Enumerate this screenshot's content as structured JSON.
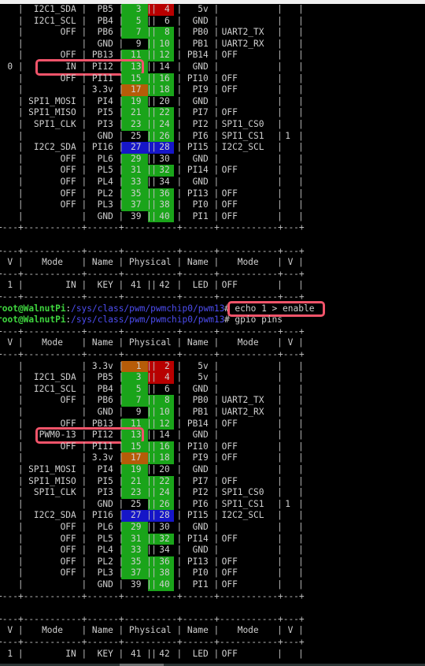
{
  "terminal": {
    "prompt_user": "root@WalnutPi",
    "prompt_path": "/sys/class/pwm/pwmchip0/pwm13",
    "commands": [
      {
        "text": "echo 1 > enable",
        "highlighted": true
      },
      {
        "text": "gpio pins",
        "highlighted": false
      }
    ]
  },
  "table_header": {
    "v": "V",
    "mode": "Mode",
    "name": "Name",
    "physical": "Physical"
  },
  "tables": [
    {
      "id": "before",
      "rows": [
        {
          "lv": "",
          "lmode": "I2C1_SDA",
          "lname": "PB5",
          "lpin": "3",
          "lcolor": "green",
          "rpin": "4",
          "rcolor": "red",
          "rname": "5v",
          "rmode": "",
          "rv": ""
        },
        {
          "lv": "",
          "lmode": "I2C1_SCL",
          "lname": "PB4",
          "lpin": "5",
          "lcolor": "green",
          "rpin": "6",
          "rcolor": "none",
          "rname": "GND",
          "rmode": "",
          "rv": ""
        },
        {
          "lv": "",
          "lmode": "OFF",
          "lname": "PB6",
          "lpin": "7",
          "lcolor": "green",
          "rpin": "8",
          "rcolor": "green",
          "rname": "PB0",
          "rmode": "UART2_TX",
          "rv": ""
        },
        {
          "lv": "",
          "lmode": "",
          "lname": "GND",
          "lpin": "9",
          "lcolor": "none",
          "rpin": "10",
          "rcolor": "green",
          "rname": "PB1",
          "rmode": "UART2_RX",
          "rv": ""
        },
        {
          "lv": "",
          "lmode": "OFF",
          "lname": "PB13",
          "lpin": "11",
          "lcolor": "green",
          "rpin": "12",
          "rcolor": "green",
          "rname": "PB14",
          "rmode": "OFF",
          "rv": ""
        },
        {
          "lv": "0",
          "lmode": "IN",
          "lname": "PI12",
          "lpin": "13",
          "lcolor": "green",
          "rpin": "14",
          "rcolor": "none",
          "rname": "GND",
          "rmode": "",
          "rv": "",
          "highlight": true
        },
        {
          "lv": "",
          "lmode": "OFF",
          "lname": "PI11",
          "lpin": "15",
          "lcolor": "green",
          "rpin": "16",
          "rcolor": "green",
          "rname": "PI10",
          "rmode": "OFF",
          "rv": ""
        },
        {
          "lv": "",
          "lmode": "",
          "lname": "3.3v",
          "lpin": "17",
          "lcolor": "orange",
          "rpin": "18",
          "rcolor": "green",
          "rname": "PI9",
          "rmode": "OFF",
          "rv": ""
        },
        {
          "lv": "",
          "lmode": "SPI1_MOSI",
          "lname": "PI4",
          "lpin": "19",
          "lcolor": "green",
          "rpin": "20",
          "rcolor": "none",
          "rname": "GND",
          "rmode": "",
          "rv": ""
        },
        {
          "lv": "",
          "lmode": "SPI1_MISO",
          "lname": "PI5",
          "lpin": "21",
          "lcolor": "green",
          "rpin": "22",
          "rcolor": "green",
          "rname": "PI7",
          "rmode": "OFF",
          "rv": ""
        },
        {
          "lv": "",
          "lmode": "SPI1_CLK",
          "lname": "PI3",
          "lpin": "23",
          "lcolor": "green",
          "rpin": "24",
          "rcolor": "green",
          "rname": "PI2",
          "rmode": "SPI1_CS0",
          "rv": ""
        },
        {
          "lv": "",
          "lmode": "",
          "lname": "GND",
          "lpin": "25",
          "lcolor": "none",
          "rpin": "26",
          "rcolor": "green",
          "rname": "PI6",
          "rmode": "SPI1_CS1",
          "rv": "1"
        },
        {
          "lv": "",
          "lmode": "I2C2_SDA",
          "lname": "PI16",
          "lpin": "27",
          "lcolor": "blue",
          "rpin": "28",
          "rcolor": "blue",
          "rname": "PI15",
          "rmode": "I2C2_SCL",
          "rv": ""
        },
        {
          "lv": "",
          "lmode": "OFF",
          "lname": "PL6",
          "lpin": "29",
          "lcolor": "green",
          "rpin": "30",
          "rcolor": "none",
          "rname": "GND",
          "rmode": "",
          "rv": ""
        },
        {
          "lv": "",
          "lmode": "OFF",
          "lname": "PL5",
          "lpin": "31",
          "lcolor": "green",
          "rpin": "32",
          "rcolor": "green",
          "rname": "PI14",
          "rmode": "OFF",
          "rv": ""
        },
        {
          "lv": "",
          "lmode": "OFF",
          "lname": "PL4",
          "lpin": "33",
          "lcolor": "green",
          "rpin": "34",
          "rcolor": "none",
          "rname": "GND",
          "rmode": "",
          "rv": ""
        },
        {
          "lv": "",
          "lmode": "OFF",
          "lname": "PL2",
          "lpin": "35",
          "lcolor": "green",
          "rpin": "36",
          "rcolor": "green",
          "rname": "PI13",
          "rmode": "OFF",
          "rv": ""
        },
        {
          "lv": "",
          "lmode": "OFF",
          "lname": "PL3",
          "lpin": "37",
          "lcolor": "green",
          "rpin": "38",
          "rcolor": "green",
          "rname": "PI0",
          "rmode": "OFF",
          "rv": ""
        },
        {
          "lv": "",
          "lmode": "",
          "lname": "GND",
          "lpin": "39",
          "lcolor": "none",
          "rpin": "40",
          "rcolor": "green",
          "rname": "PI1",
          "rmode": "OFF",
          "rv": ""
        }
      ],
      "extra_row": {
        "lv": "1",
        "lmode": "IN",
        "lname": "KEY",
        "lpin": "41",
        "rpin": "42",
        "rname": "LED",
        "rmode": "OFF",
        "rv": ""
      }
    },
    {
      "id": "after",
      "rows": [
        {
          "lv": "",
          "lmode": "",
          "lname": "3.3v",
          "lpin": "1",
          "lcolor": "orange",
          "rpin": "2",
          "rcolor": "red",
          "rname": "5v",
          "rmode": "",
          "rv": ""
        },
        {
          "lv": "",
          "lmode": "I2C1_SDA",
          "lname": "PB5",
          "lpin": "3",
          "lcolor": "green",
          "rpin": "4",
          "rcolor": "red",
          "rname": "5v",
          "rmode": "",
          "rv": ""
        },
        {
          "lv": "",
          "lmode": "I2C1_SCL",
          "lname": "PB4",
          "lpin": "5",
          "lcolor": "green",
          "rpin": "6",
          "rcolor": "none",
          "rname": "GND",
          "rmode": "",
          "rv": ""
        },
        {
          "lv": "",
          "lmode": "OFF",
          "lname": "PB6",
          "lpin": "7",
          "lcolor": "green",
          "rpin": "8",
          "rcolor": "green",
          "rname": "PB0",
          "rmode": "UART2_TX",
          "rv": ""
        },
        {
          "lv": "",
          "lmode": "",
          "lname": "GND",
          "lpin": "9",
          "lcolor": "none",
          "rpin": "10",
          "rcolor": "green",
          "rname": "PB1",
          "rmode": "UART2_RX",
          "rv": ""
        },
        {
          "lv": "",
          "lmode": "OFF",
          "lname": "PB13",
          "lpin": "11",
          "lcolor": "green",
          "rpin": "12",
          "rcolor": "green",
          "rname": "PB14",
          "rmode": "OFF",
          "rv": ""
        },
        {
          "lv": "",
          "lmode": "PWM0-13",
          "lname": "PI12",
          "lpin": "13",
          "lcolor": "green",
          "rpin": "14",
          "rcolor": "none",
          "rname": "GND",
          "rmode": "",
          "rv": "",
          "highlight": true
        },
        {
          "lv": "",
          "lmode": "OFF",
          "lname": "PI11",
          "lpin": "15",
          "lcolor": "green",
          "rpin": "16",
          "rcolor": "green",
          "rname": "PI10",
          "rmode": "OFF",
          "rv": ""
        },
        {
          "lv": "",
          "lmode": "",
          "lname": "3.3v",
          "lpin": "17",
          "lcolor": "orange",
          "rpin": "18",
          "rcolor": "green",
          "rname": "PI9",
          "rmode": "OFF",
          "rv": ""
        },
        {
          "lv": "",
          "lmode": "SPI1_MOSI",
          "lname": "PI4",
          "lpin": "19",
          "lcolor": "green",
          "rpin": "20",
          "rcolor": "none",
          "rname": "GND",
          "rmode": "",
          "rv": ""
        },
        {
          "lv": "",
          "lmode": "SPI1_MISO",
          "lname": "PI5",
          "lpin": "21",
          "lcolor": "green",
          "rpin": "22",
          "rcolor": "green",
          "rname": "PI7",
          "rmode": "OFF",
          "rv": ""
        },
        {
          "lv": "",
          "lmode": "SPI1_CLK",
          "lname": "PI3",
          "lpin": "23",
          "lcolor": "green",
          "rpin": "24",
          "rcolor": "green",
          "rname": "PI2",
          "rmode": "SPI1_CS0",
          "rv": ""
        },
        {
          "lv": "",
          "lmode": "",
          "lname": "GND",
          "lpin": "25",
          "lcolor": "none",
          "rpin": "26",
          "rcolor": "green",
          "rname": "PI6",
          "rmode": "SPI1_CS1",
          "rv": "1"
        },
        {
          "lv": "",
          "lmode": "I2C2_SDA",
          "lname": "PI16",
          "lpin": "27",
          "lcolor": "blue",
          "rpin": "28",
          "rcolor": "blue",
          "rname": "PI15",
          "rmode": "I2C2_SCL",
          "rv": ""
        },
        {
          "lv": "",
          "lmode": "OFF",
          "lname": "PL6",
          "lpin": "29",
          "lcolor": "green",
          "rpin": "30",
          "rcolor": "none",
          "rname": "GND",
          "rmode": "",
          "rv": ""
        },
        {
          "lv": "",
          "lmode": "OFF",
          "lname": "PL5",
          "lpin": "31",
          "lcolor": "green",
          "rpin": "32",
          "rcolor": "green",
          "rname": "PI14",
          "rmode": "OFF",
          "rv": ""
        },
        {
          "lv": "",
          "lmode": "OFF",
          "lname": "PL4",
          "lpin": "33",
          "lcolor": "green",
          "rpin": "34",
          "rcolor": "none",
          "rname": "GND",
          "rmode": "",
          "rv": ""
        },
        {
          "lv": "",
          "lmode": "OFF",
          "lname": "PL2",
          "lpin": "35",
          "lcolor": "green",
          "rpin": "36",
          "rcolor": "green",
          "rname": "PI13",
          "rmode": "OFF",
          "rv": ""
        },
        {
          "lv": "",
          "lmode": "OFF",
          "lname": "PL3",
          "lpin": "37",
          "lcolor": "green",
          "rpin": "38",
          "rcolor": "green",
          "rname": "PI0",
          "rmode": "OFF",
          "rv": ""
        },
        {
          "lv": "",
          "lmode": "",
          "lname": "GND",
          "lpin": "39",
          "lcolor": "none",
          "rpin": "40",
          "rcolor": "green",
          "rname": "PI1",
          "rmode": "OFF",
          "rv": ""
        }
      ],
      "extra_row": {
        "lv": "1",
        "lmode": "IN",
        "lname": "KEY",
        "lpin": "41",
        "rpin": "42",
        "rname": "LED",
        "rmode": "OFF",
        "rv": ""
      }
    }
  ]
}
